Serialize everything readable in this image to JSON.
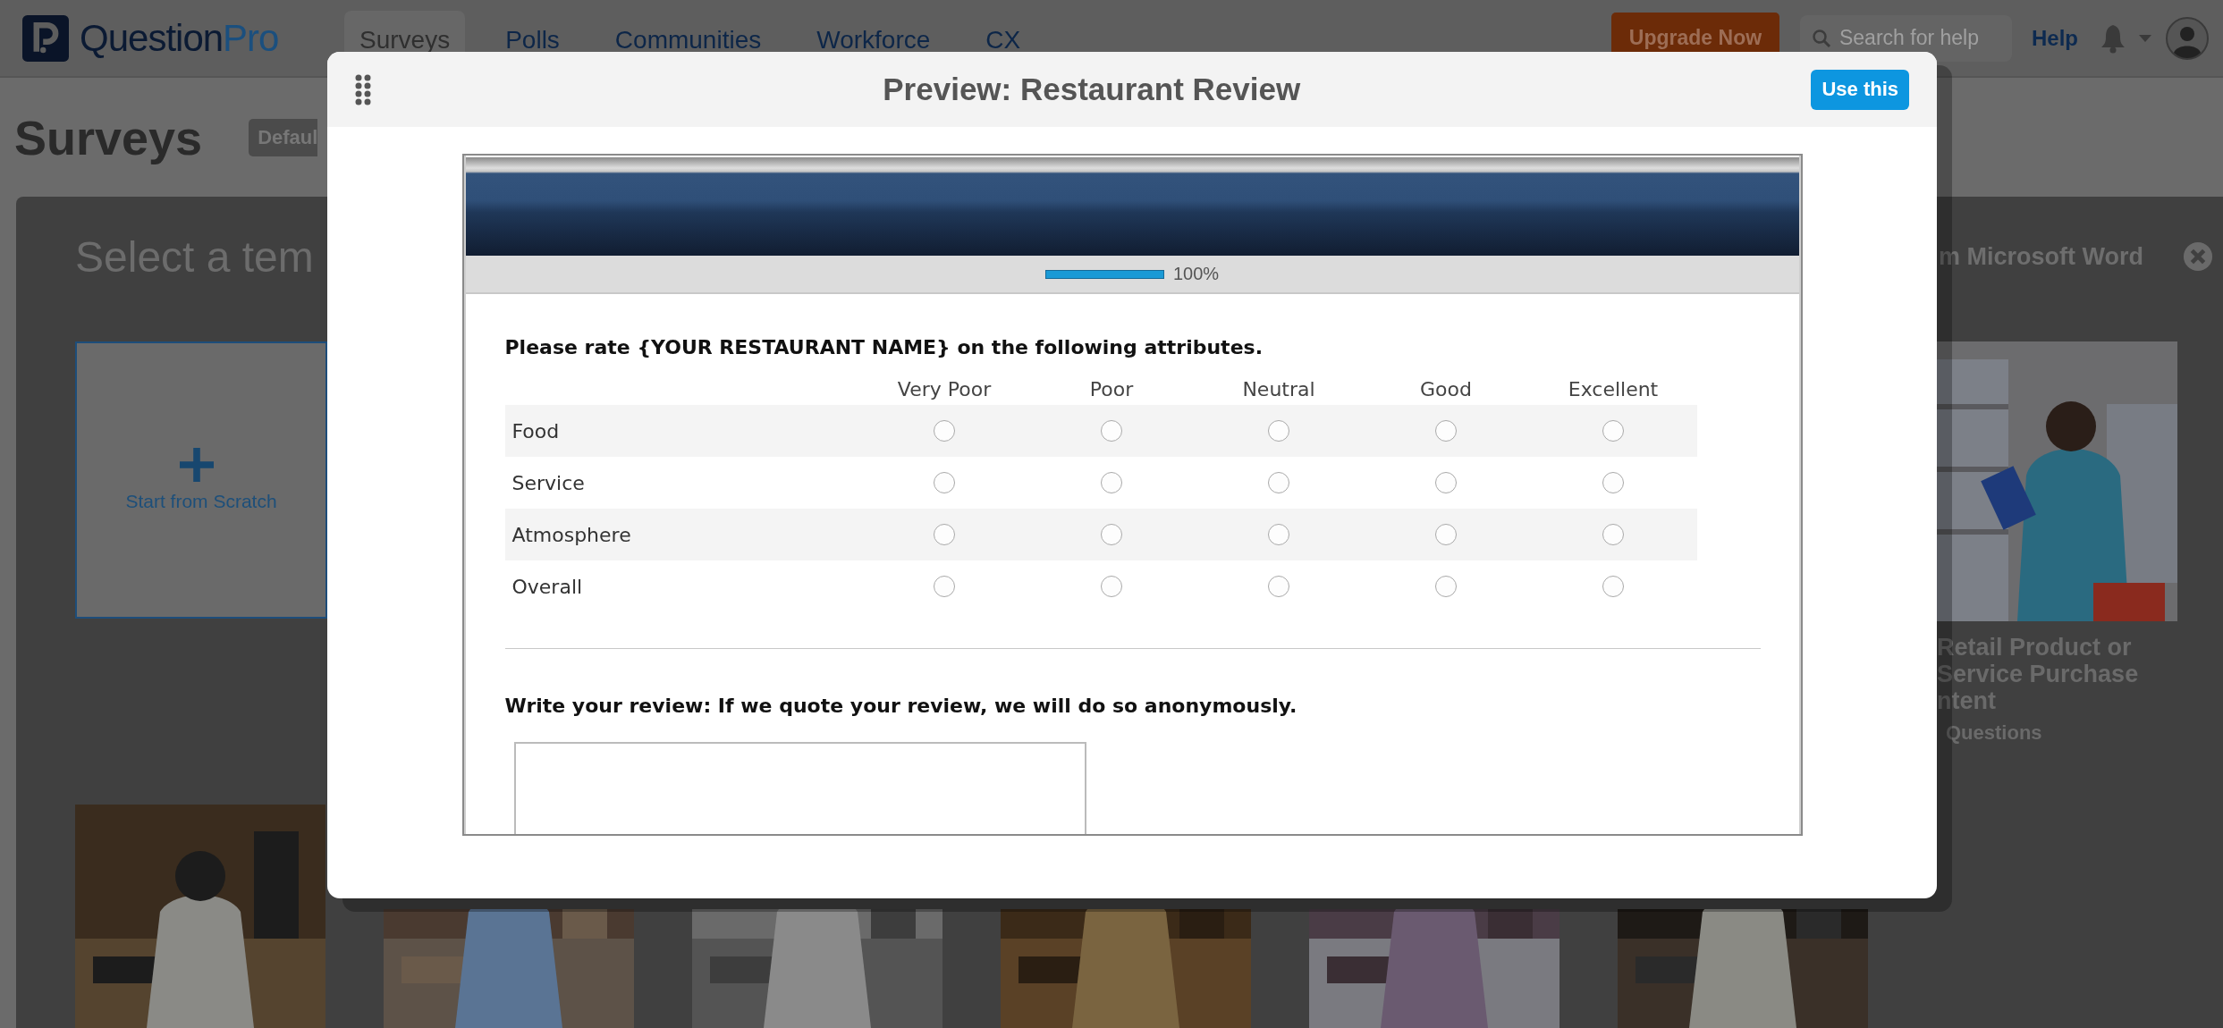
{
  "top_nav": {
    "logo": {
      "text_main": "Question",
      "text_accent": "Pro"
    },
    "tabs": [
      {
        "label": "Surveys",
        "selected": true
      },
      {
        "label": "Polls",
        "selected": false
      },
      {
        "label": "Communities",
        "selected": false
      },
      {
        "label": "Workforce",
        "selected": false
      },
      {
        "label": "CX",
        "selected": false
      }
    ],
    "upgrade_button": "Upgrade Now",
    "search": {
      "placeholder": "Search for help"
    },
    "help_link": "Help"
  },
  "page": {
    "title": "Surveys",
    "folder_badge": "Defaul"
  },
  "template_panel": {
    "heading": "Select a tem",
    "import_link": "m Microsoft Word",
    "scratch_card": {
      "label": "Start from Scratch"
    },
    "featured_template": {
      "photo": {
        "kind": "picture"
      },
      "title_lines": [
        "Retail Product or",
        "Service Purchase",
        "ntent"
      ],
      "meta": "Questions"
    },
    "photos": [
      {
        "kind": "picture"
      },
      {
        "kind": "picture"
      },
      {
        "kind": "picture"
      },
      {
        "kind": "picture"
      },
      {
        "kind": "picture"
      },
      {
        "kind": "picture"
      }
    ]
  },
  "modal": {
    "title": "Preview: Restaurant Review",
    "use_button": "Use this",
    "survey": {
      "progress": {
        "level": 1,
        "label": "100%"
      },
      "questions": [
        {
          "kind": "matrix",
          "text": "Please rate {YOUR RESTAURANT NAME} on the following attributes.",
          "scale": [
            "Very Poor",
            "Poor",
            "Neutral",
            "Good",
            "Excellent"
          ],
          "rows": [
            {
              "label": "Food",
              "choices": [
                {
                  "selected": false
                },
                {
                  "selected": false
                },
                {
                  "selected": false
                },
                {
                  "selected": false
                },
                {
                  "selected": false
                }
              ]
            },
            {
              "label": "Service",
              "choices": [
                {
                  "selected": false
                },
                {
                  "selected": false
                },
                {
                  "selected": false
                },
                {
                  "selected": false
                },
                {
                  "selected": false
                }
              ]
            },
            {
              "label": "Atmosphere",
              "choices": [
                {
                  "selected": false
                },
                {
                  "selected": false
                },
                {
                  "selected": false
                },
                {
                  "selected": false
                },
                {
                  "selected": false
                }
              ]
            },
            {
              "label": "Overall",
              "choices": [
                {
                  "selected": false
                },
                {
                  "selected": false
                },
                {
                  "selected": false
                },
                {
                  "selected": false
                },
                {
                  "selected": false
                }
              ]
            }
          ]
        },
        {
          "kind": "text_area",
          "text": "Write your review: If we quote your review, we will do so anonymously."
        }
      ]
    }
  }
}
